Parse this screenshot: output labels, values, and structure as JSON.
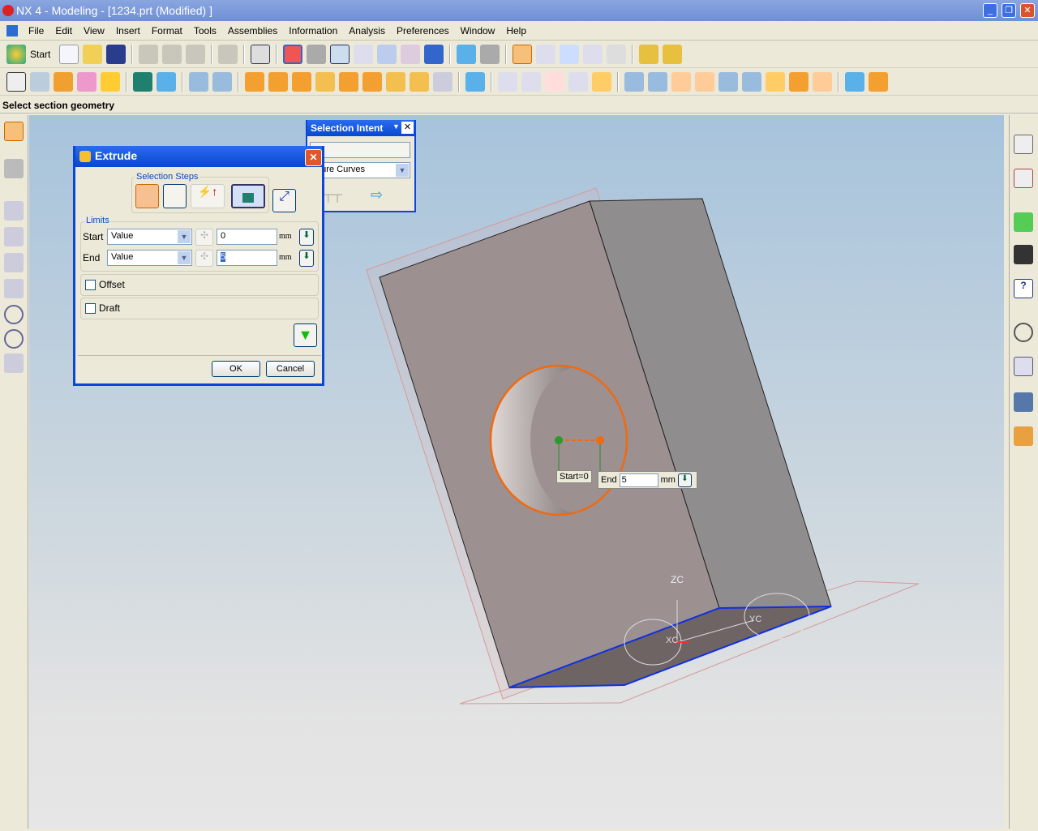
{
  "window": {
    "title": "NX 4 - Modeling - [1234.prt (Modified) ]"
  },
  "menu": [
    "File",
    "Edit",
    "View",
    "Insert",
    "Format",
    "Tools",
    "Assemblies",
    "Information",
    "Analysis",
    "Preferences",
    "Window",
    "Help"
  ],
  "toolbar": {
    "start_label": "Start"
  },
  "status": {
    "prompt": "Select section geometry"
  },
  "extrude": {
    "title": "Extrude",
    "selection_steps_label": "Selection Steps",
    "limits_label": "Limits",
    "start": {
      "label": "Start",
      "type": "Value",
      "value": "0",
      "unit": "mm"
    },
    "end": {
      "label": "End",
      "type": "Value",
      "value": "5",
      "unit": "mm"
    },
    "offset": {
      "label": "Offset",
      "checked": false
    },
    "draft": {
      "label": "Draft",
      "checked": false
    },
    "ok": "OK",
    "cancel": "Cancel"
  },
  "selection_intent": {
    "title": "Selection Intent",
    "filter_value": "",
    "rule_value": "ature Curves"
  },
  "viewport": {
    "start_tag": "Start=0",
    "end_tag": {
      "label": "End",
      "value": "5",
      "unit": "mm"
    },
    "axes": {
      "z": "ZC",
      "x": "XC",
      "y": "YC"
    }
  },
  "colors": {
    "title_blue": "#0847d0",
    "edge_orange": "#f06a10",
    "face": "#9a9090",
    "sel_blue": "#1030e0"
  }
}
